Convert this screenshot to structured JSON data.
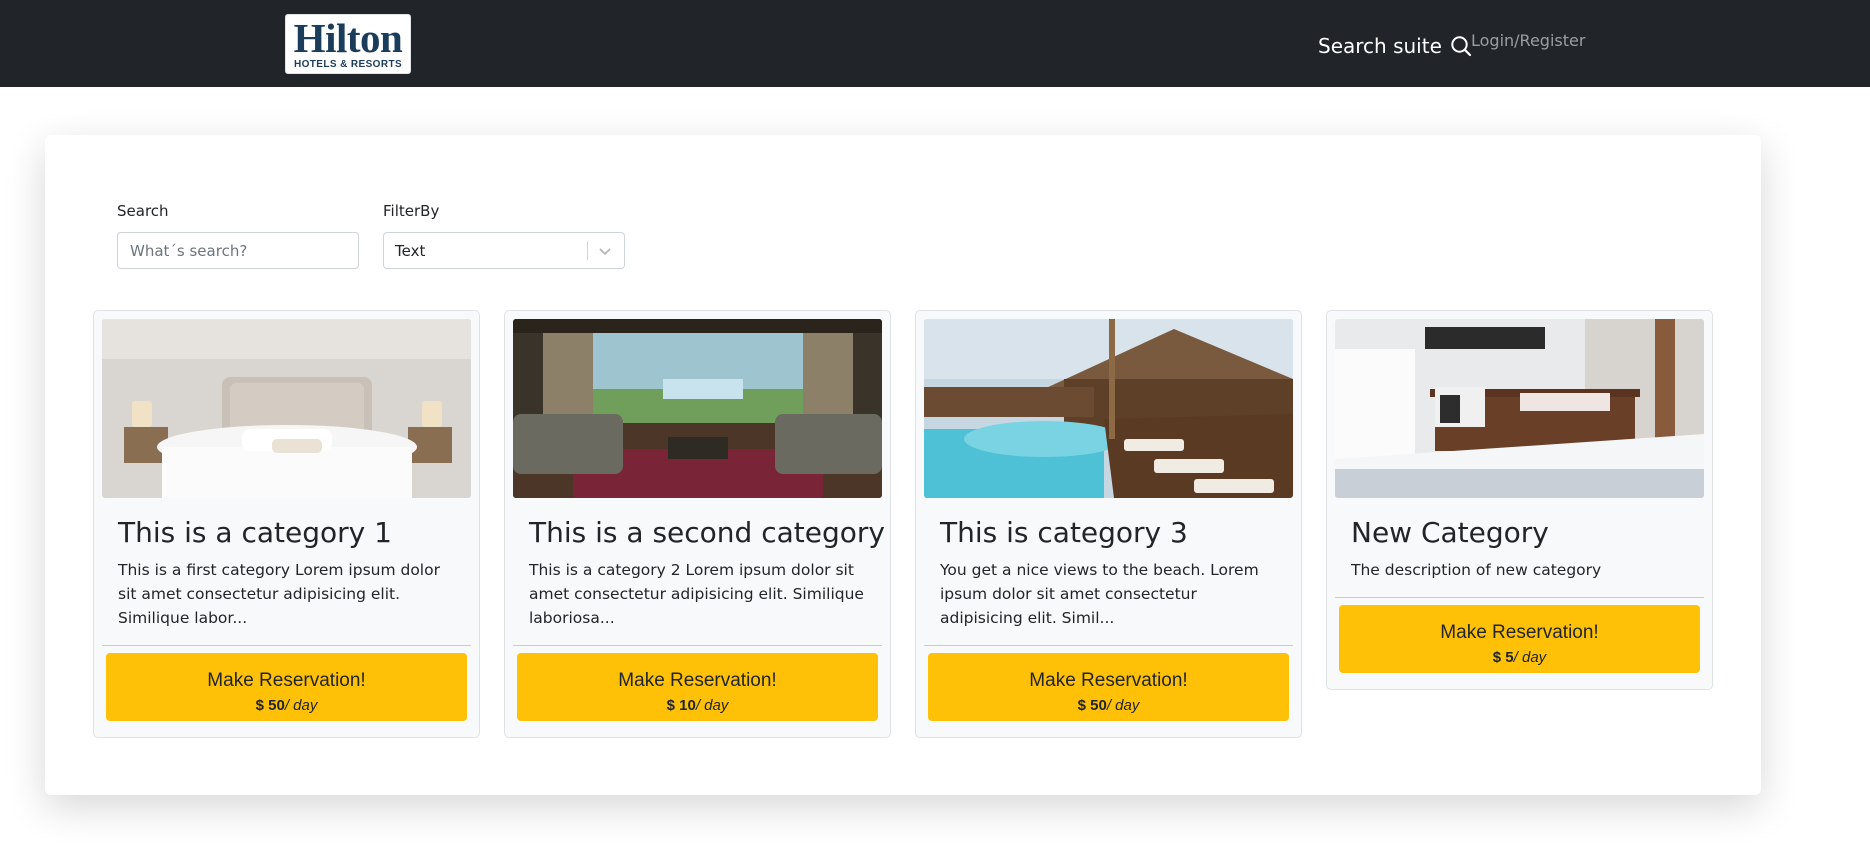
{
  "navbar": {
    "logo_text": "Hilton",
    "logo_subtext": "HOTELS & RESORTS",
    "search_label": "Search suite",
    "login_label": "Login/Register"
  },
  "filters": {
    "search_label": "Search",
    "search_placeholder": "What´s search?",
    "search_value": "",
    "filter_label": "FilterBy",
    "filter_selected": "Text"
  },
  "cards": [
    {
      "title": "This is a category 1",
      "description": "This is a first category Lorem ipsum dolor sit amet consectetur adipisicing elit. Similique labor...",
      "button_label": "Make Reservation!",
      "price": "$ 50",
      "price_unit": "/ day"
    },
    {
      "title": "This is a second category",
      "description": "This is a category 2 Lorem ipsum dolor sit amet consectetur adipisicing elit. Similique laboriosa...",
      "button_label": "Make Reservation!",
      "price": "$ 10",
      "price_unit": "/ day"
    },
    {
      "title": "This is category 3",
      "description": "You get a nice views to the beach. Lorem ipsum dolor sit amet consectetur adipisicing elit. Simil...",
      "button_label": "Make Reservation!",
      "price": "$ 50",
      "price_unit": "/ day"
    },
    {
      "title": "New Category",
      "description": "The description of new category",
      "button_label": "Make Reservation!",
      "price": "$ 5",
      "price_unit": "/ day"
    }
  ],
  "colors": {
    "navbar_bg": "#212529",
    "button_bg": "#ffc107",
    "card_bg": "#f8f9fa",
    "logo_blue": "#1b3d5c"
  }
}
